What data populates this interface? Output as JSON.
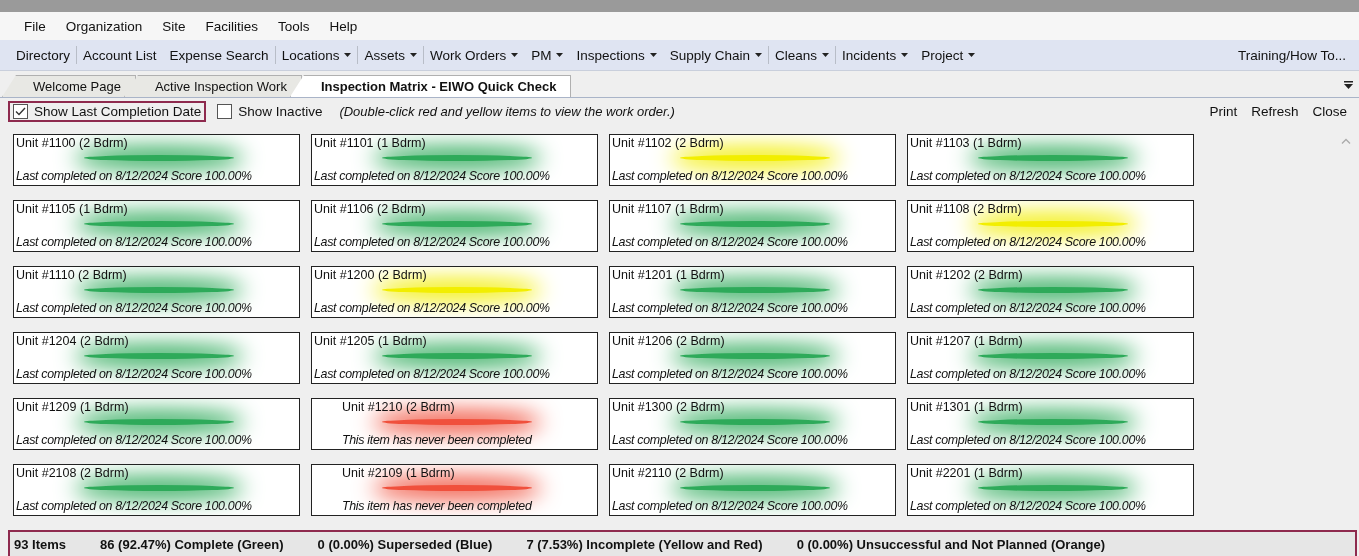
{
  "menu_bar": [
    "File",
    "Organization",
    "Site",
    "Facilities",
    "Tools",
    "Help"
  ],
  "toolbar": {
    "items": [
      {
        "label": "Directory",
        "dropdown": false,
        "separator_after": true
      },
      {
        "label": "Account List",
        "dropdown": false,
        "separator_after": false
      },
      {
        "label": "Expense Search",
        "dropdown": false,
        "separator_after": true
      },
      {
        "label": "Locations",
        "dropdown": true,
        "separator_after": true
      },
      {
        "label": "Assets",
        "dropdown": true,
        "separator_after": true
      },
      {
        "label": "Work Orders",
        "dropdown": true,
        "separator_after": false
      },
      {
        "label": "PM",
        "dropdown": true,
        "separator_after": false
      },
      {
        "label": "Inspections",
        "dropdown": true,
        "separator_after": false
      },
      {
        "label": "Supply Chain",
        "dropdown": true,
        "separator_after": true
      },
      {
        "label": "Cleans",
        "dropdown": true,
        "separator_after": true
      },
      {
        "label": "Incidents",
        "dropdown": true,
        "separator_after": false
      },
      {
        "label": "Project",
        "dropdown": true,
        "separator_after": false
      }
    ],
    "right_link": "Training/How To..."
  },
  "tabs": [
    {
      "label": "Welcome Page",
      "selected": false
    },
    {
      "label": "Active Inspection Work",
      "selected": false
    },
    {
      "label": "Inspection Matrix - EIWO Quick Check",
      "selected": true
    }
  ],
  "options": {
    "checkboxes": [
      {
        "label": "Show Last Completion Date",
        "checked": true
      },
      {
        "label": "Show Inactive",
        "checked": false
      }
    ],
    "hint": "(Double-click red and yellow items to view the work order.)",
    "actions": [
      "Print",
      "Refresh",
      "Close"
    ]
  },
  "units": [
    {
      "title": "Unit #1100 (2 Bdrm)",
      "status": "Last completed on 8/12/2024 Score 100.00%",
      "color": "#2eaa5a"
    },
    {
      "title": "Unit #1101 (1 Bdrm)",
      "status": "Last completed on 8/12/2024 Score 100.00%",
      "color": "#2eaa5a"
    },
    {
      "title": "Unit #1102 (2 Bdrm)",
      "status": "Last completed on 8/12/2024 Score 100.00%",
      "color": "#f2ee00"
    },
    {
      "title": "Unit #1103 (1 Bdrm)",
      "status": "Last completed on 8/12/2024 Score 100.00%",
      "color": "#2eaa5a"
    },
    {
      "title": "Unit #1105 (1 Bdrm)",
      "status": "Last completed on 8/12/2024 Score 100.00%",
      "color": "#2eaa5a"
    },
    {
      "title": "Unit #1106 (2 Bdrm)",
      "status": "Last completed on 8/12/2024 Score 100.00%",
      "color": "#2eaa5a"
    },
    {
      "title": "Unit #1107 (1 Bdrm)",
      "status": "Last completed on 8/12/2024 Score 100.00%",
      "color": "#2eaa5a"
    },
    {
      "title": "Unit #1108 (2 Bdrm)",
      "status": "Last completed on 8/12/2024 Score 100.00%",
      "color": "#f2ee00"
    },
    {
      "title": "Unit #1110 (2 Bdrm)",
      "status": "Last completed on 8/12/2024 Score 100.00%",
      "color": "#2eaa5a"
    },
    {
      "title": "Unit #1200 (2 Bdrm)",
      "status": "Last completed on 8/12/2024 Score 100.00%",
      "color": "#f2ee00"
    },
    {
      "title": "Unit #1201 (1 Bdrm)",
      "status": "Last completed on 8/12/2024 Score 100.00%",
      "color": "#2eaa5a"
    },
    {
      "title": "Unit #1202 (2 Bdrm)",
      "status": "Last completed on 8/12/2024 Score 100.00%",
      "color": "#2eaa5a"
    },
    {
      "title": "Unit #1204 (2 Bdrm)",
      "status": "Last completed on 8/12/2024 Score 100.00%",
      "color": "#2eaa5a"
    },
    {
      "title": "Unit #1205 (1 Bdrm)",
      "status": "Last completed on 8/12/2024 Score 100.00%",
      "color": "#2eaa5a"
    },
    {
      "title": "Unit #1206 (2 Bdrm)",
      "status": "Last completed on 8/12/2024 Score 100.00%",
      "color": "#2eaa5a"
    },
    {
      "title": "Unit #1207 (1 Bdrm)",
      "status": "Last completed on 8/12/2024 Score 100.00%",
      "color": "#2eaa5a"
    },
    {
      "title": "Unit #1209 (1 Bdrm)",
      "status": "Last completed on 8/12/2024 Score 100.00%",
      "color": "#2eaa5a"
    },
    {
      "title": "Unit #1210 (2 Bdrm)",
      "status": "This item has never been completed",
      "color": "#f0503c"
    },
    {
      "title": "Unit #1300 (2 Bdrm)",
      "status": "Last completed on 8/12/2024 Score 100.00%",
      "color": "#2eaa5a"
    },
    {
      "title": "Unit #1301 (1 Bdrm)",
      "status": "Last completed on 8/12/2024 Score 100.00%",
      "color": "#2eaa5a"
    },
    {
      "title": "Unit #2108 (2 Bdrm)",
      "status": "Last completed on 8/12/2024 Score 100.00%",
      "color": "#2eaa5a"
    },
    {
      "title": "Unit #2109 (1 Bdrm)",
      "status": "This item has never been completed",
      "color": "#f0503c"
    },
    {
      "title": "Unit #2110 (2 Bdrm)",
      "status": "Last completed on 8/12/2024 Score 100.00%",
      "color": "#2eaa5a"
    },
    {
      "title": "Unit #2201 (1 Bdrm)",
      "status": "Last completed on 8/12/2024 Score 100.00%",
      "color": "#2eaa5a"
    }
  ],
  "status_bar": [
    "93 Items",
    "86 (92.47%) Complete (Green)",
    "0 (0.00%) Superseded (Blue)",
    "7 (7.53%) Incomplete (Yellow and Red)",
    "0 (0.00%) Unsuccessful and Not Planned (Orange)"
  ]
}
